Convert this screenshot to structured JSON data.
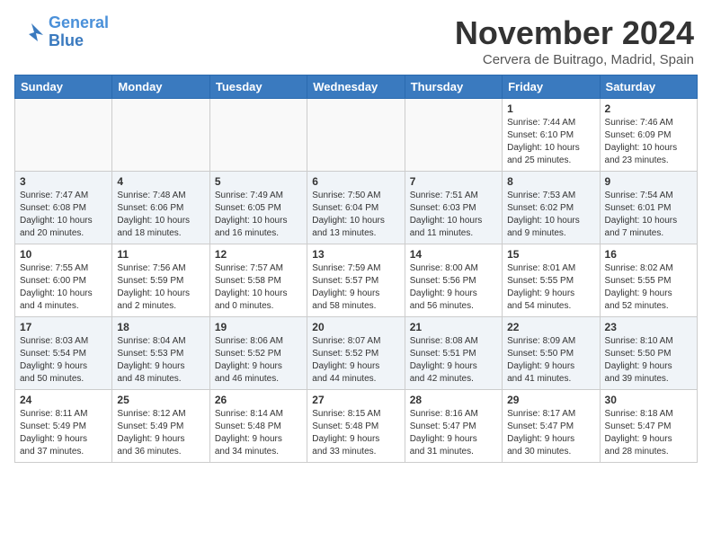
{
  "header": {
    "logo_text1": "General",
    "logo_text2": "Blue",
    "month_title": "November 2024",
    "location": "Cervera de Buitrago, Madrid, Spain"
  },
  "days_of_week": [
    "Sunday",
    "Monday",
    "Tuesday",
    "Wednesday",
    "Thursday",
    "Friday",
    "Saturday"
  ],
  "weeks": [
    [
      {
        "day": "",
        "info": ""
      },
      {
        "day": "",
        "info": ""
      },
      {
        "day": "",
        "info": ""
      },
      {
        "day": "",
        "info": ""
      },
      {
        "day": "",
        "info": ""
      },
      {
        "day": "1",
        "info": "Sunrise: 7:44 AM\nSunset: 6:10 PM\nDaylight: 10 hours\nand 25 minutes."
      },
      {
        "day": "2",
        "info": "Sunrise: 7:46 AM\nSunset: 6:09 PM\nDaylight: 10 hours\nand 23 minutes."
      }
    ],
    [
      {
        "day": "3",
        "info": "Sunrise: 7:47 AM\nSunset: 6:08 PM\nDaylight: 10 hours\nand 20 minutes."
      },
      {
        "day": "4",
        "info": "Sunrise: 7:48 AM\nSunset: 6:06 PM\nDaylight: 10 hours\nand 18 minutes."
      },
      {
        "day": "5",
        "info": "Sunrise: 7:49 AM\nSunset: 6:05 PM\nDaylight: 10 hours\nand 16 minutes."
      },
      {
        "day": "6",
        "info": "Sunrise: 7:50 AM\nSunset: 6:04 PM\nDaylight: 10 hours\nand 13 minutes."
      },
      {
        "day": "7",
        "info": "Sunrise: 7:51 AM\nSunset: 6:03 PM\nDaylight: 10 hours\nand 11 minutes."
      },
      {
        "day": "8",
        "info": "Sunrise: 7:53 AM\nSunset: 6:02 PM\nDaylight: 10 hours\nand 9 minutes."
      },
      {
        "day": "9",
        "info": "Sunrise: 7:54 AM\nSunset: 6:01 PM\nDaylight: 10 hours\nand 7 minutes."
      }
    ],
    [
      {
        "day": "10",
        "info": "Sunrise: 7:55 AM\nSunset: 6:00 PM\nDaylight: 10 hours\nand 4 minutes."
      },
      {
        "day": "11",
        "info": "Sunrise: 7:56 AM\nSunset: 5:59 PM\nDaylight: 10 hours\nand 2 minutes."
      },
      {
        "day": "12",
        "info": "Sunrise: 7:57 AM\nSunset: 5:58 PM\nDaylight: 10 hours\nand 0 minutes."
      },
      {
        "day": "13",
        "info": "Sunrise: 7:59 AM\nSunset: 5:57 PM\nDaylight: 9 hours\nand 58 minutes."
      },
      {
        "day": "14",
        "info": "Sunrise: 8:00 AM\nSunset: 5:56 PM\nDaylight: 9 hours\nand 56 minutes."
      },
      {
        "day": "15",
        "info": "Sunrise: 8:01 AM\nSunset: 5:55 PM\nDaylight: 9 hours\nand 54 minutes."
      },
      {
        "day": "16",
        "info": "Sunrise: 8:02 AM\nSunset: 5:55 PM\nDaylight: 9 hours\nand 52 minutes."
      }
    ],
    [
      {
        "day": "17",
        "info": "Sunrise: 8:03 AM\nSunset: 5:54 PM\nDaylight: 9 hours\nand 50 minutes."
      },
      {
        "day": "18",
        "info": "Sunrise: 8:04 AM\nSunset: 5:53 PM\nDaylight: 9 hours\nand 48 minutes."
      },
      {
        "day": "19",
        "info": "Sunrise: 8:06 AM\nSunset: 5:52 PM\nDaylight: 9 hours\nand 46 minutes."
      },
      {
        "day": "20",
        "info": "Sunrise: 8:07 AM\nSunset: 5:52 PM\nDaylight: 9 hours\nand 44 minutes."
      },
      {
        "day": "21",
        "info": "Sunrise: 8:08 AM\nSunset: 5:51 PM\nDaylight: 9 hours\nand 42 minutes."
      },
      {
        "day": "22",
        "info": "Sunrise: 8:09 AM\nSunset: 5:50 PM\nDaylight: 9 hours\nand 41 minutes."
      },
      {
        "day": "23",
        "info": "Sunrise: 8:10 AM\nSunset: 5:50 PM\nDaylight: 9 hours\nand 39 minutes."
      }
    ],
    [
      {
        "day": "24",
        "info": "Sunrise: 8:11 AM\nSunset: 5:49 PM\nDaylight: 9 hours\nand 37 minutes."
      },
      {
        "day": "25",
        "info": "Sunrise: 8:12 AM\nSunset: 5:49 PM\nDaylight: 9 hours\nand 36 minutes."
      },
      {
        "day": "26",
        "info": "Sunrise: 8:14 AM\nSunset: 5:48 PM\nDaylight: 9 hours\nand 34 minutes."
      },
      {
        "day": "27",
        "info": "Sunrise: 8:15 AM\nSunset: 5:48 PM\nDaylight: 9 hours\nand 33 minutes."
      },
      {
        "day": "28",
        "info": "Sunrise: 8:16 AM\nSunset: 5:47 PM\nDaylight: 9 hours\nand 31 minutes."
      },
      {
        "day": "29",
        "info": "Sunrise: 8:17 AM\nSunset: 5:47 PM\nDaylight: 9 hours\nand 30 minutes."
      },
      {
        "day": "30",
        "info": "Sunrise: 8:18 AM\nSunset: 5:47 PM\nDaylight: 9 hours\nand 28 minutes."
      }
    ]
  ]
}
